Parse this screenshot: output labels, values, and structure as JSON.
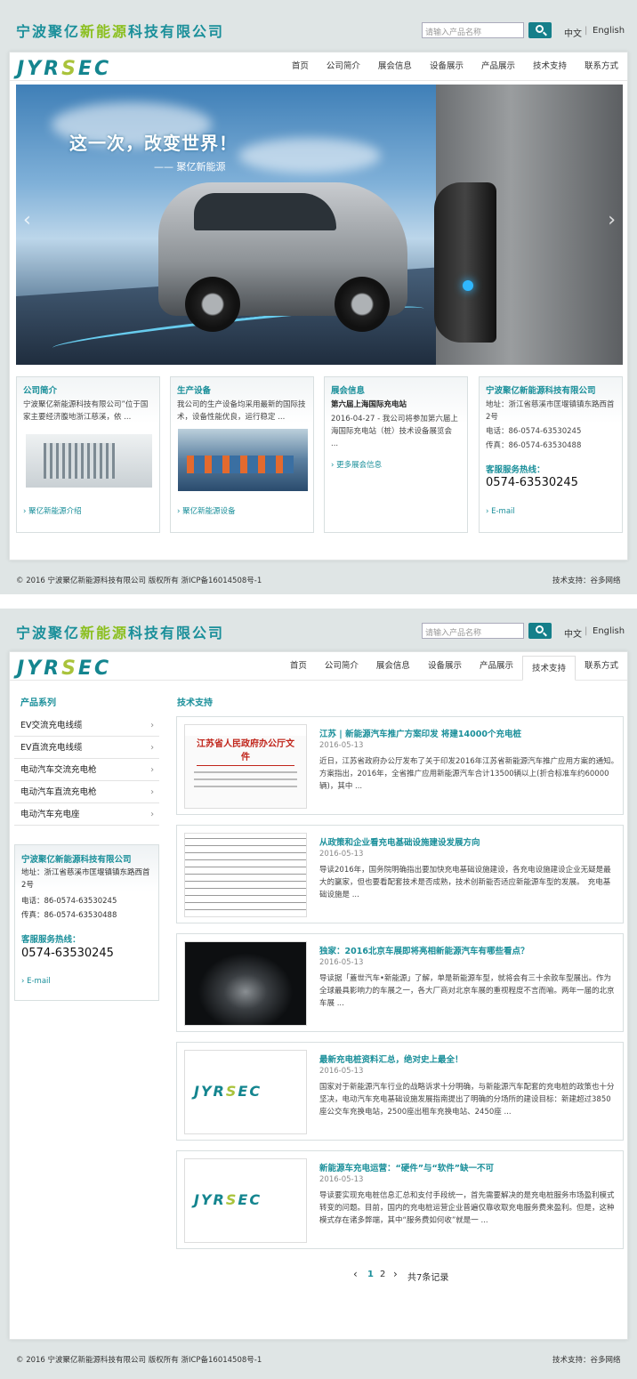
{
  "site": {
    "title_a": "宁波聚亿",
    "title_b": "新能源",
    "title_c": "科技有限公司",
    "search_placeholder": "请输入产品名称",
    "lang_cn": "中文",
    "lang_sep": "|",
    "lang_en": "English",
    "logo_a": "JYR",
    "logo_b": "S",
    "logo_c": "EC"
  },
  "nav": [
    "首页",
    "公司简介",
    "展会信息",
    "设备展示",
    "产品展示",
    "技术支持",
    "联系方式"
  ],
  "banner": {
    "slogan": "这一次，改变世界！",
    "sub": "—— 聚亿新能源",
    "prev": "‹",
    "next": "›"
  },
  "boxes": {
    "intro": {
      "title": "公司简介",
      "text": "宁波聚亿新能源科技有限公司”位于国家主要经济腹地浙江慈溪，依 ...",
      "more": "聚亿新能源介绍"
    },
    "equip": {
      "title": "生产设备",
      "text": "我公司的生产设备均采用最新的国际技术，设备性能优良，运行稳定 ...",
      "more": "聚亿新能源设备"
    },
    "expo": {
      "title": "展会信息",
      "headline": "第六届上海国际充电站",
      "text": "2016-04-27 - 我公司将参加第六届上海国际充电站（桩）技术设备展览会 ...",
      "more": "更多展会信息"
    }
  },
  "contact": {
    "company": "宁波聚亿新能源科技有限公司",
    "addr": "地址：浙江省慈溪市匡堰镇镇东路西首2号",
    "tel": "电话：86-0574-63530245",
    "fax": "传真：86-0574-63530488",
    "hotline_label": "客服服务热线：",
    "hotline": "0574-63530245",
    "email": "E-mail"
  },
  "footer": {
    "left": "© 2016 宁波聚亿新能源科技有限公司 版权所有   浙ICP备16014508号-1",
    "right": "技术支持：谷多网络"
  },
  "page2": {
    "side_title": "产品系列",
    "categories": [
      "EV交流充电线缆",
      "EV直流充电线缆",
      "电动汽车交流充电枪",
      "电动汽车直流充电枪",
      "电动汽车充电座"
    ],
    "chev": "›",
    "list_title": "技术支持",
    "articles": [
      {
        "title": "江苏 | 新能源汽车推广方案印发 将建14000个充电桩",
        "date": "2016-05-13",
        "text": "近日，江苏省政府办公厅发布了关于印发2016年江苏省新能源汽车推广应用方案的通知。　方案指出，2016年，全省推广应用新能源汽车合计13500辆以上(折合标准车约60000辆)，其中 ...",
        "thumb_title": "江苏省人民政府办公厅文件"
      },
      {
        "title": "从政策和企业看充电基础设施建设发展方向",
        "date": "2016-05-13",
        "text": "导读2016年，国务院明确指出要加快充电基础设施建设，各充电设施建设企业无疑是最大的赢家，但也要看配套技术是否成熟，技术创新能否适应新能源车型的发展。　充电基础设施是 ..."
      },
      {
        "title": "独家：2016北京车展即将亮相新能源汽车有哪些看点？",
        "date": "2016-05-13",
        "text": "导读据「蓋世汽车•新能源」了解，单是新能源车型，就将会有三十余款车型展出。作为全球最具影响力的车展之一，各大厂商对北京车展的重视程度不言而喻。两年一届的北京车展 ..."
      },
      {
        "title": "最新充电桩资料汇总，绝对史上最全！",
        "date": "2016-05-13",
        "text": "国家对于新能源汽车行业的战略诉求十分明确，与新能源汽车配套的充电桩的政策也十分坚决，电动汽车充电基础设施发展指南提出了明确的分场所的建设目标：新建超过3850座公交车充换电站，2500座出租车充换电站、2450座 ..."
      },
      {
        "title": "新能源车充电运营：“硬件”与“软件”缺一不可",
        "date": "2016-05-13",
        "text": "导读要实现充电桩信息汇总和支付手段统一，首先需要解决的是充电桩服务市场盈利模式转变的问题。目前，国内的充电桩运营企业普遍仅靠收取充电服务费来盈利。但是，这种模式存在诸多弊端，其中“服务费如何收”就是一 ..."
      }
    ],
    "pager": {
      "prev": "‹",
      "p1": "1",
      "p2": "2",
      "next": "›",
      "total": "共7条记录"
    }
  },
  "colors": {
    "accent": "#1a8f9a",
    "green": "#8bbf1f"
  }
}
